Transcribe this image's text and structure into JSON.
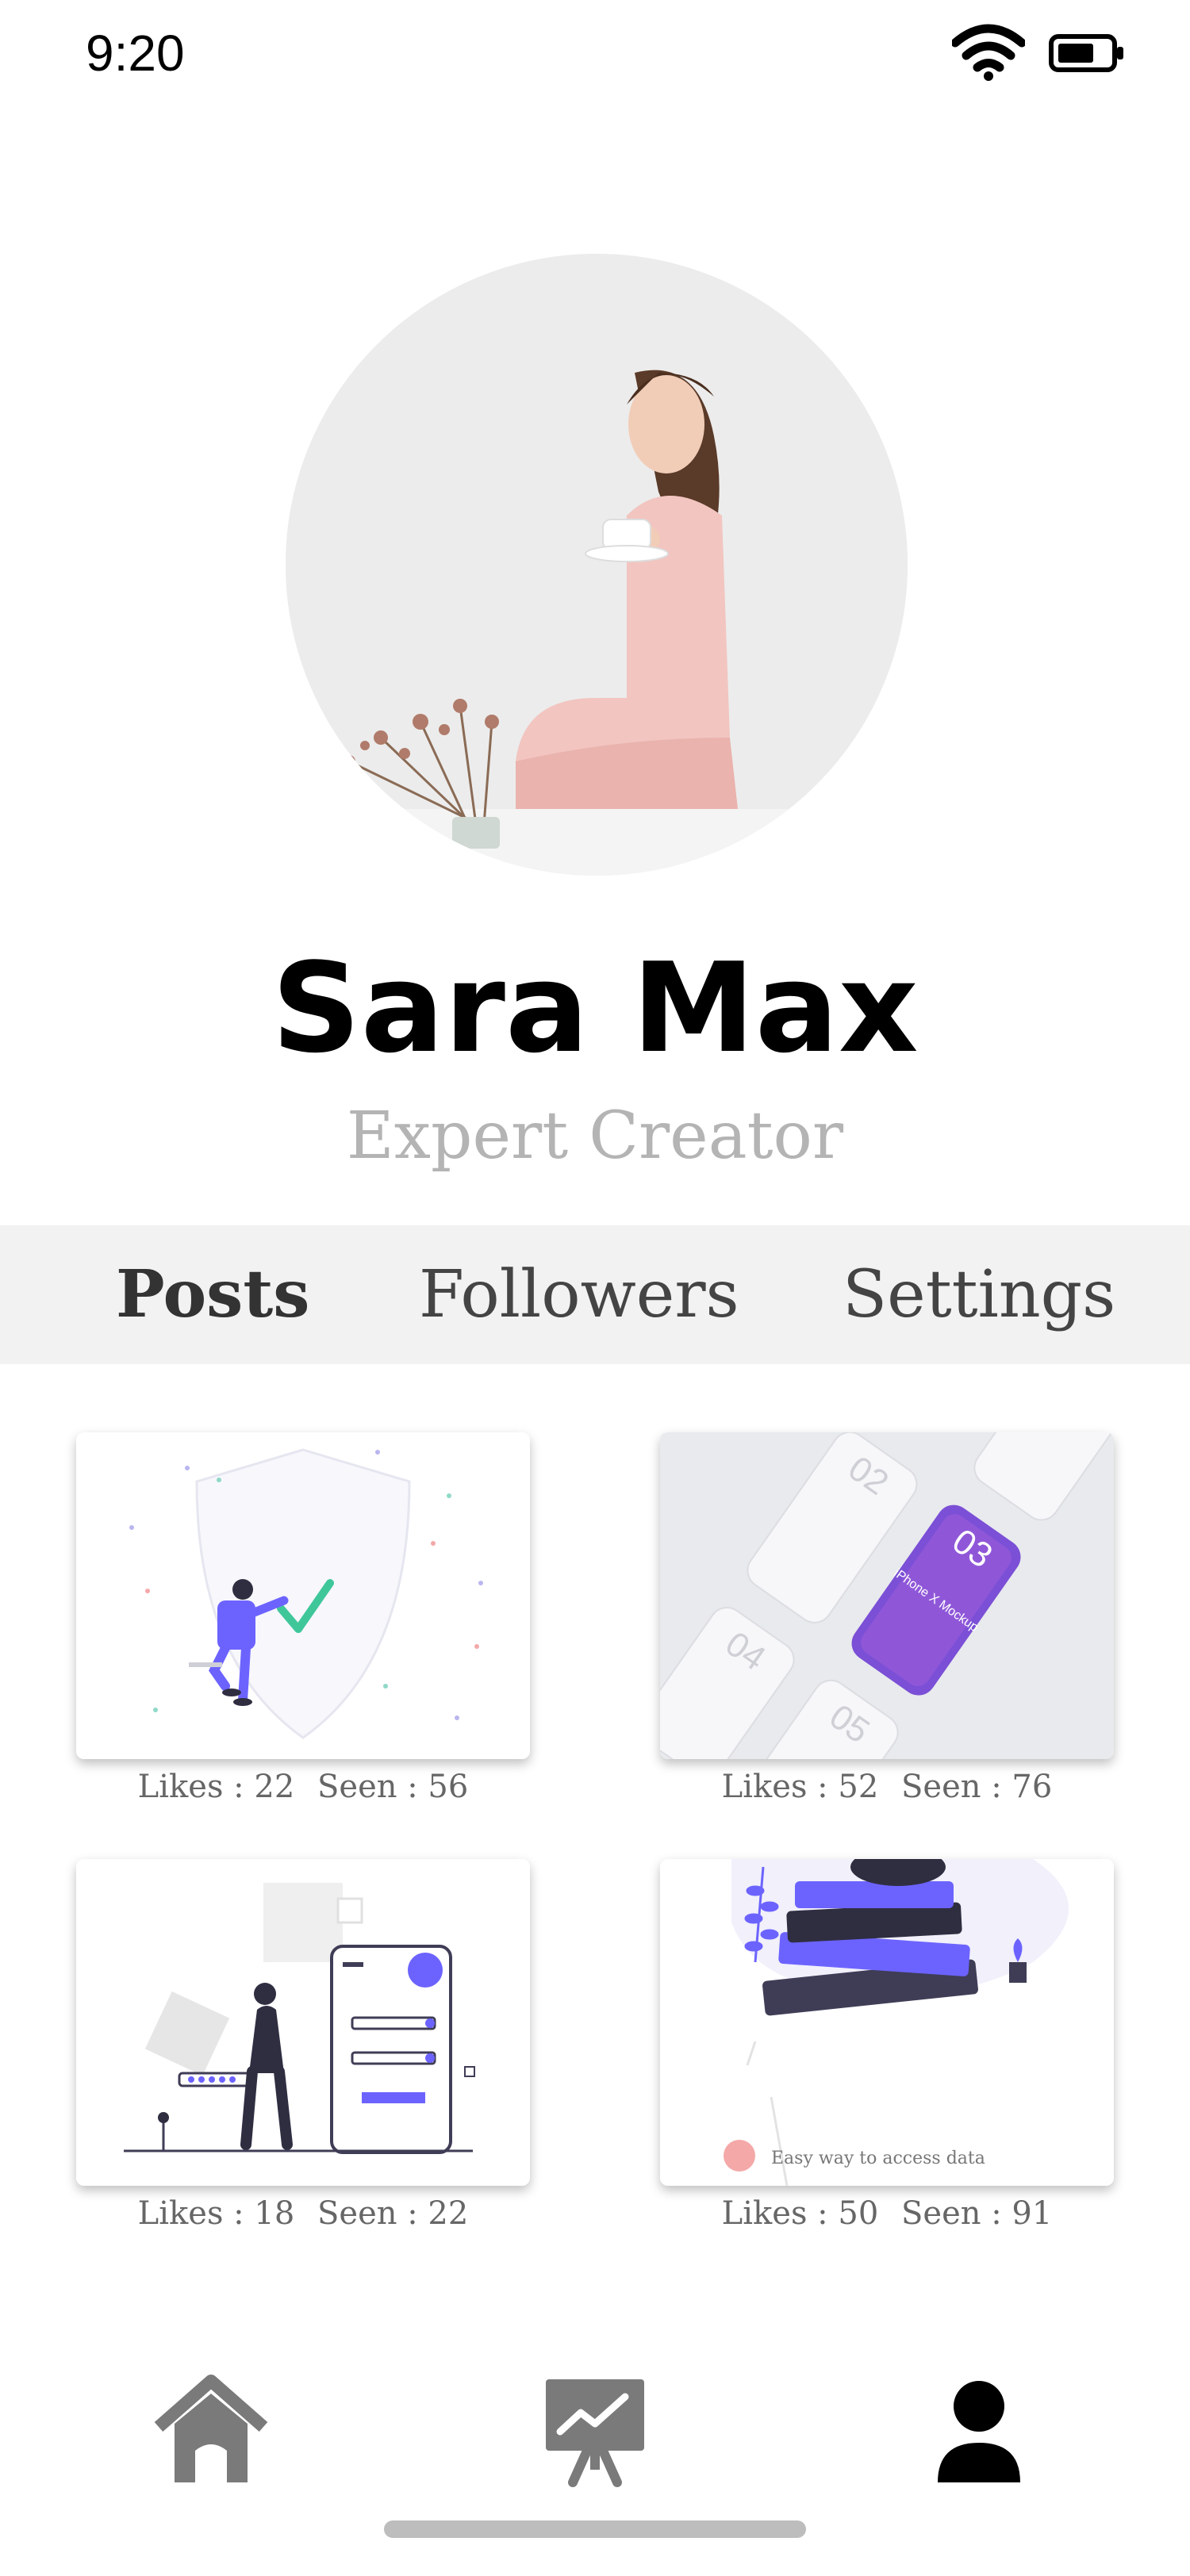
{
  "status": {
    "time": "9:20",
    "icons": [
      "wifi-icon",
      "battery-icon"
    ]
  },
  "profile": {
    "name": "Sara Max",
    "role": "Expert Creator",
    "avatar": "profile-photo"
  },
  "tabs": [
    {
      "label": "Posts",
      "active": true
    },
    {
      "label": "Followers",
      "active": false
    },
    {
      "label": "Settings",
      "active": false
    }
  ],
  "posts": [
    {
      "likes_label": "Likes : 22",
      "seen_label": "Seen : 56"
    },
    {
      "likes_label": "Likes : 52",
      "seen_label": "Seen : 76",
      "mockup_numbers": [
        "02",
        "03",
        "04",
        "05"
      ],
      "mockup_text": "iPhone X Mockup"
    },
    {
      "likes_label": "Likes : 18",
      "seen_label": "Seen : 22"
    },
    {
      "likes_label": "Likes : 50",
      "seen_label": "Seen : 91",
      "caption": "Easy way to access data"
    }
  ],
  "bottom_nav": [
    {
      "icon": "home-icon",
      "active": false
    },
    {
      "icon": "presentation-chart-icon",
      "active": false
    },
    {
      "icon": "user-icon",
      "active": true
    }
  ],
  "colors": {
    "accent": "#6c63ff",
    "inactive_icon": "#7a7a7a",
    "tab_bar": "#f2f2f2"
  }
}
